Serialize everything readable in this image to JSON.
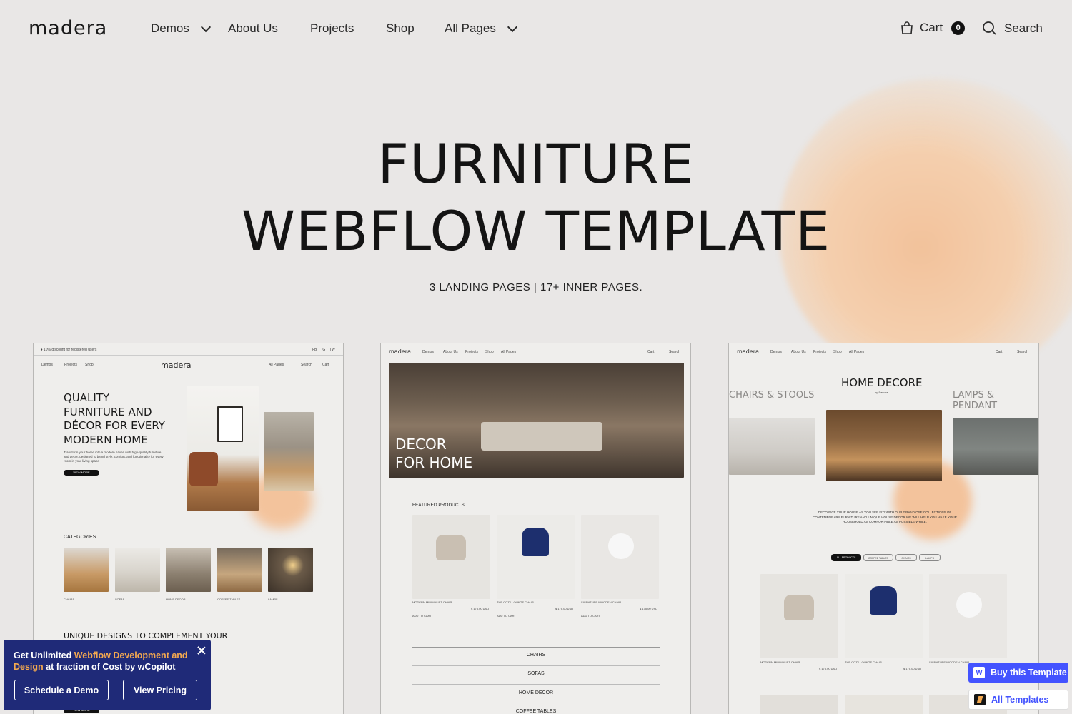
{
  "header": {
    "logo": "madera",
    "nav": [
      {
        "label": "Demos",
        "dropdown": true
      },
      {
        "label": "About Us",
        "dropdown": false
      },
      {
        "label": "Projects",
        "dropdown": false
      },
      {
        "label": "Shop",
        "dropdown": false
      },
      {
        "label": "All Pages",
        "dropdown": true
      }
    ],
    "cart_label": "Cart",
    "cart_count": "0",
    "search_label": "Search"
  },
  "hero": {
    "title_line1": "FURNITURE",
    "title_line2": "WEBFLOW TEMPLATE",
    "subtitle": "3 LANDING PAGES | 17+ INNER PAGES."
  },
  "demo1": {
    "topbar": "♦ 10% discount for registered users",
    "social": [
      "FB",
      "IG",
      "TW"
    ],
    "nav_left": [
      "Demos",
      "Projects",
      "Shop"
    ],
    "logo": "madera",
    "nav_right": [
      "All Pages",
      "Search",
      "Cart"
    ],
    "headline": [
      "QUALITY",
      "FURNITURE AND",
      "DÉCOR FOR EVERY",
      "MODERN HOME"
    ],
    "body": "Transform your home into a modern haven with high-quality furniture and decor, designed to blend style, comfort, and functionality for every room in your living space",
    "button": "VIEW MORE",
    "categories_title": "CATEGORIES",
    "categories": [
      "CHAIRS",
      "SOFAS",
      "HOME DECOR",
      "COFFEE TABLES",
      "LAMPS"
    ],
    "section2": "UNIQUE DESIGNS TO COMPLEMENT YOUR"
  },
  "demo2": {
    "logo": "madera",
    "nav": [
      "Demos",
      "About Us",
      "Projects",
      "Shop",
      "All Pages"
    ],
    "nav_right": [
      "Cart",
      "Search"
    ],
    "hero_text": [
      "DECOR",
      "FOR HOME"
    ],
    "featured_title": "FEATURED PRODUCTS",
    "products": [
      {
        "name": "MODERN MINIMALIST CHAIR",
        "price": "$ 175.00 USD"
      },
      {
        "name": "THE COZY LOUNGE CHAIR",
        "price": "$ 175.00 USD"
      },
      {
        "name": "SIGNATURE WOODEN CHAIR",
        "price": "$ 175.00 USD"
      }
    ],
    "add_to_cart": "ADD TO CART",
    "menu": [
      "CHAIRS",
      "SOFAS",
      "HOME DECOR",
      "COFFEE TABLES"
    ]
  },
  "demo3": {
    "logo": "madera",
    "nav": [
      "Demos",
      "About Us",
      "Projects",
      "Shop",
      "All Pages"
    ],
    "nav_right": [
      "Cart",
      "Search"
    ],
    "slide_left": "CHAIRS & STOOLS",
    "slide_center": "HOME DECORE",
    "slide_right": "LAMPS & PENDANT",
    "byline": "by Sandra",
    "description": "DECORATE YOUR HOUSE AS YOU SEE FIT! WITH OUR GRANDIOSE COLLECTIONS OF CONTEMPORARY FURNITURE AND UNIQUE HOUSE DÉCOR WE WILL HELP YOU MAKE YOUR HOUSEHOLD AS COMFORTABLE AS POSSIBLE WHILE.",
    "filters": [
      "ALL PRODUCTS",
      "COFFEE TABLES",
      "CHAIRS",
      "LAMPS"
    ],
    "products": [
      {
        "name": "MODERN MINIMALIST CHAIR",
        "price": "$ 175.00 USD"
      },
      {
        "name": "THE COZY LOUNGE CHAIR",
        "price": "$ 175.00 USD"
      },
      {
        "name": "SIGNATURE WOODEN CHAIR",
        "price": "$ 175.00 USD"
      }
    ]
  },
  "popup": {
    "text_pre": "Get Unlimited ",
    "text_highlight": "Webflow Development and Design",
    "text_post": " at fraction of Cost by wCopilot",
    "schedule": "Schedule a Demo",
    "pricing": "View Pricing"
  },
  "side": {
    "buy": "Buy this Template",
    "all": "All Templates"
  },
  "colors": {
    "accent_peach": "#f2c39a",
    "popup_bg": "#1f2a78",
    "popup_highlight": "#f4a94f",
    "buy_bg": "#4353ff"
  }
}
